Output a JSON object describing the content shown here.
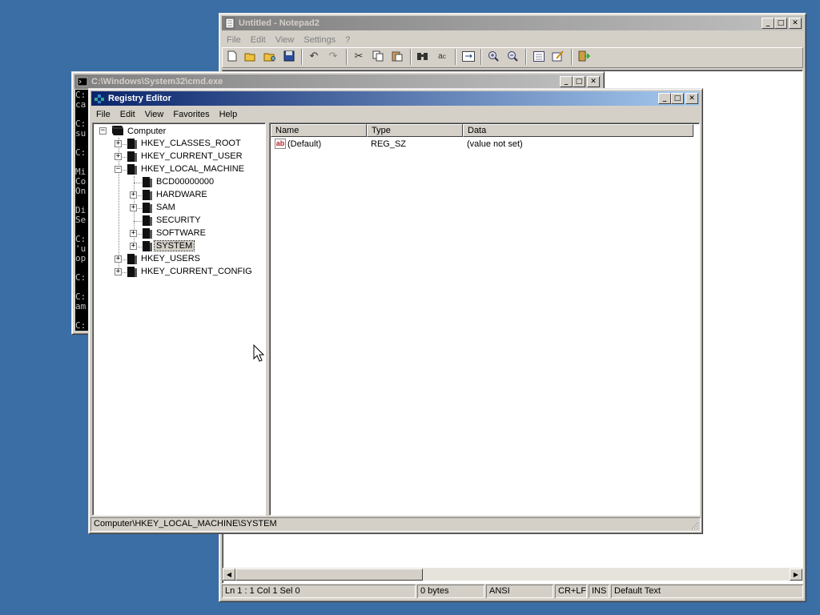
{
  "notepad": {
    "title": "Untitled - Notepad2",
    "menu": [
      "File",
      "Edit",
      "View",
      "Settings",
      "?"
    ],
    "status": {
      "position": "Ln 1 : 1   Col 1   Sel 0",
      "size": "0 bytes",
      "encoding": "ANSI",
      "line_endings": "CR+LF",
      "insert_mode": "INS",
      "scheme": "Default Text"
    }
  },
  "cmd": {
    "title": "C:\\Windows\\System32\\cmd.exe",
    "visible_lines": [
      "C:",
      "ca",
      "",
      "C:",
      "su",
      "",
      "C:",
      "",
      "Mi",
      "Co",
      "On",
      "",
      "Di",
      "Se",
      "",
      "C:",
      "'u",
      "op",
      "",
      "C:",
      "",
      "C:",
      "am",
      "",
      "C:"
    ]
  },
  "regedit": {
    "title": "Registry Editor",
    "menu": [
      "File",
      "Edit",
      "View",
      "Favorites",
      "Help"
    ],
    "tree": {
      "root": "Computer",
      "nodes": [
        {
          "label": "HKEY_CLASSES_ROOT",
          "expander": "+"
        },
        {
          "label": "HKEY_CURRENT_USER",
          "expander": "+"
        },
        {
          "label": "HKEY_LOCAL_MACHINE",
          "expander": "−"
        },
        {
          "label": "BCD00000000",
          "expander": ""
        },
        {
          "label": "HARDWARE",
          "expander": "+"
        },
        {
          "label": "SAM",
          "expander": "+"
        },
        {
          "label": "SECURITY",
          "expander": ""
        },
        {
          "label": "SOFTWARE",
          "expander": "+"
        },
        {
          "label": "SYSTEM",
          "expander": "+"
        },
        {
          "label": "HKEY_USERS",
          "expander": "+"
        },
        {
          "label": "HKEY_CURRENT_CONFIG",
          "expander": "+"
        }
      ]
    },
    "columns": [
      "Name",
      "Type",
      "Data"
    ],
    "values": [
      {
        "name": "(Default)",
        "type": "REG_SZ",
        "data": "(value not set)",
        "icon": "ab"
      }
    ],
    "status_path": "Computer\\HKEY_LOCAL_MACHINE\\SYSTEM"
  },
  "icons": {
    "notepad_toolbar": [
      "new-icon",
      "open-icon",
      "browse-icon",
      "save-icon",
      "undo-icon",
      "redo-icon",
      "cut-icon",
      "copy-icon",
      "paste-icon",
      "find-icon",
      "replace-icon",
      "word-wrap-icon",
      "zoom-in-icon",
      "zoom-out-icon",
      "view-icon",
      "settings-icon",
      "exit-icon"
    ]
  },
  "colors": {
    "desktop": "#3a6ea5",
    "active_title": "#0a246a",
    "inactive_title": "#808080"
  }
}
